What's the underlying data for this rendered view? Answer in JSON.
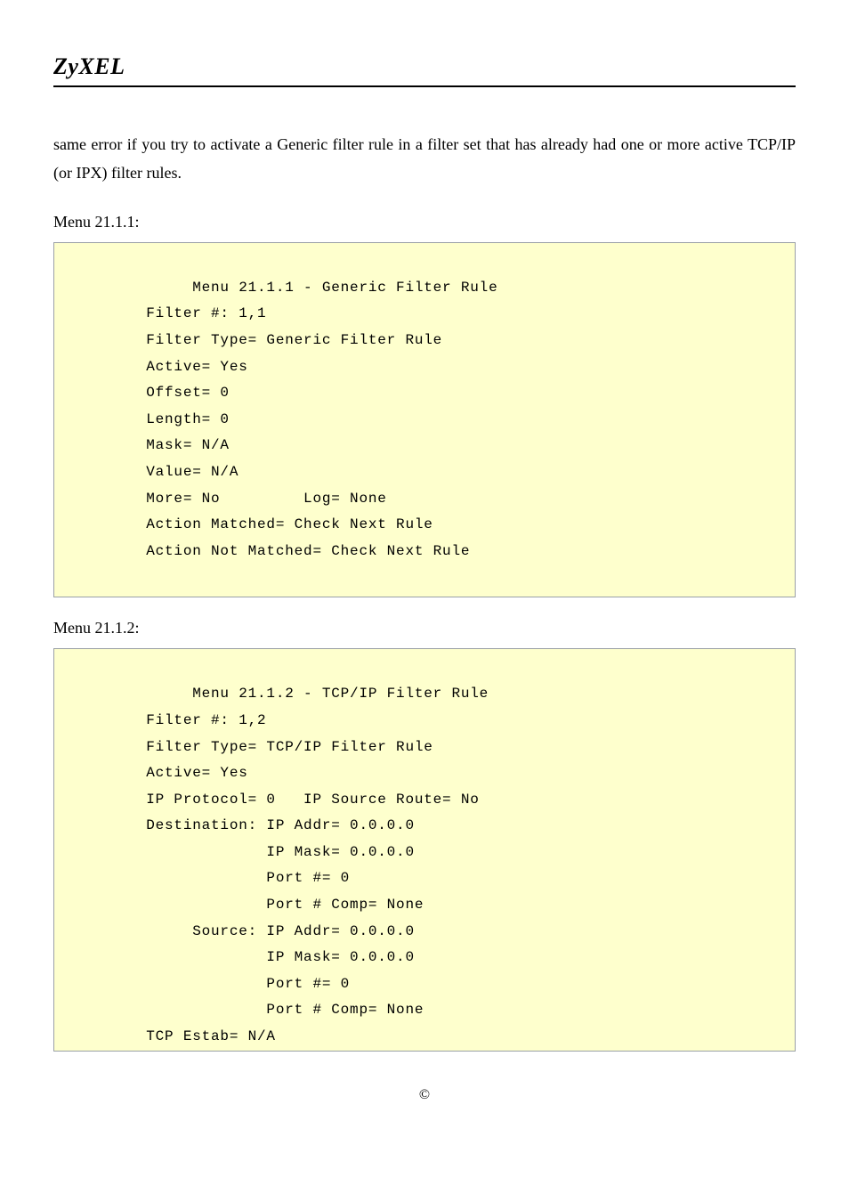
{
  "header": {
    "brand": "ZyXEL"
  },
  "intro_paragraph": "same error if you try to activate a Generic filter rule in a filter set that has already had one or more active TCP/IP (or IPX) filter rules.",
  "section1_label": "Menu 21.1.1:",
  "codebox1": "             Menu 21.1.1 - Generic Filter Rule\n        Filter #: 1,1\n        Filter Type= Generic Filter Rule\n        Active= Yes\n        Offset= 0\n        Length= 0\n        Mask= N/A\n        Value= N/A\n        More= No         Log= None\n        Action Matched= Check Next Rule\n        Action Not Matched= Check Next Rule",
  "section2_label": "Menu 21.1.2:",
  "codebox2": "             Menu 21.1.2 - TCP/IP Filter Rule\n        Filter #: 1,2\n        Filter Type= TCP/IP Filter Rule\n        Active= Yes\n        IP Protocol= 0   IP Source Route= No\n        Destination: IP Addr= 0.0.0.0\n                     IP Mask= 0.0.0.0\n                     Port #= 0\n                     Port # Comp= None\n             Source: IP Addr= 0.0.0.0\n                     IP Mask= 0.0.0.0\n                     Port #= 0\n                     Port # Comp= None\n        TCP Estab= N/A",
  "footer_symbol": "©"
}
